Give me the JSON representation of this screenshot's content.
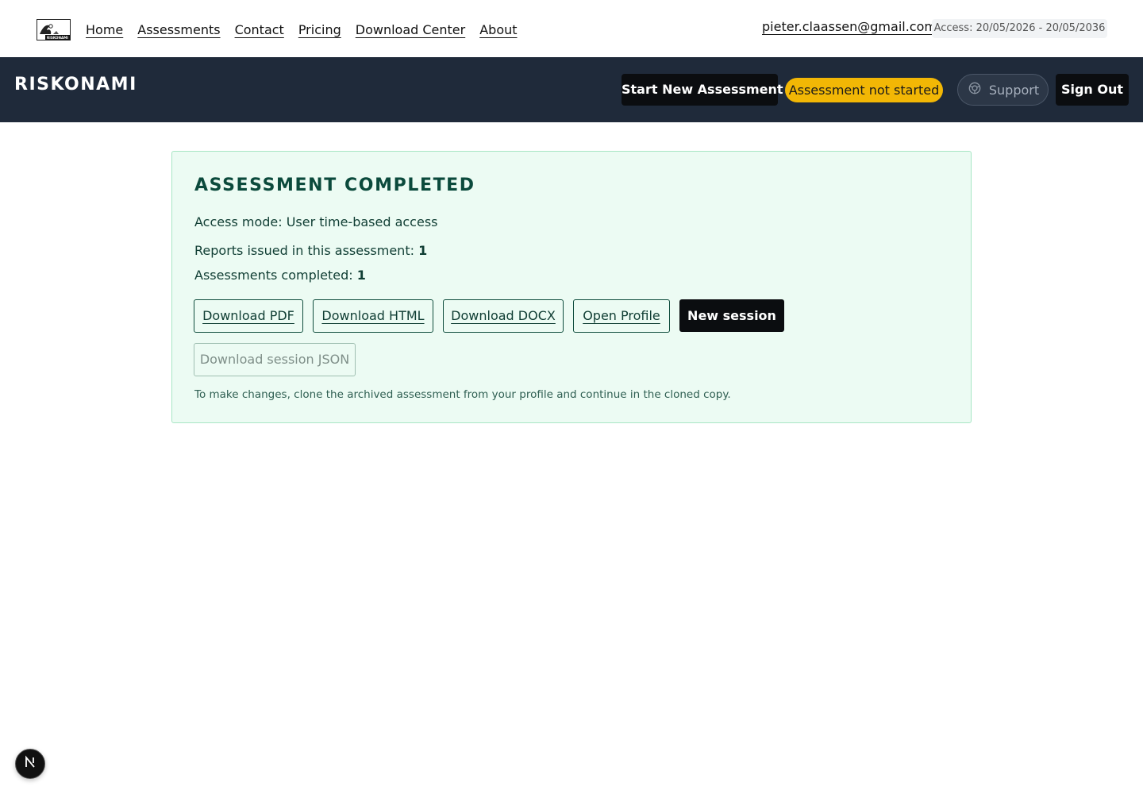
{
  "topnav": {
    "logo_text": "RISKONAMI",
    "links": [
      "Home",
      "Assessments",
      "Contact",
      "Pricing",
      "Download Center",
      "About"
    ],
    "user_email": "pieter.claassen@gmail.com",
    "access": "Access: 20/05/2026 - 20/05/2036"
  },
  "header": {
    "brand": "RISKONAMI",
    "start_button": "Start New Assessment",
    "status": "Assessment not started",
    "support_button": "Support",
    "signout_button": "Sign Out",
    "status_color": "#f2b705",
    "bg_color": "#1f2a3a"
  },
  "card": {
    "title": "ASSESSMENT COMPLETED",
    "access_mode": "Access mode: User time-based access",
    "reports_label": "Reports issued in this assessment:",
    "reports_value": "1",
    "completed_label": "Assessments completed:",
    "completed_value": "1",
    "buttons": {
      "pdf": "Download PDF",
      "html": "Download HTML",
      "docx": "Download DOCX",
      "profile": "Open Profile",
      "new_session": "New session",
      "json": "Download session JSON"
    },
    "note": "To make changes, clone the archived assessment from your profile and continue in the cloned copy.",
    "bg_color": "#ecfbf3",
    "border_color": "#a7e6c4"
  },
  "badge": {
    "icon": "n-logo-icon"
  }
}
